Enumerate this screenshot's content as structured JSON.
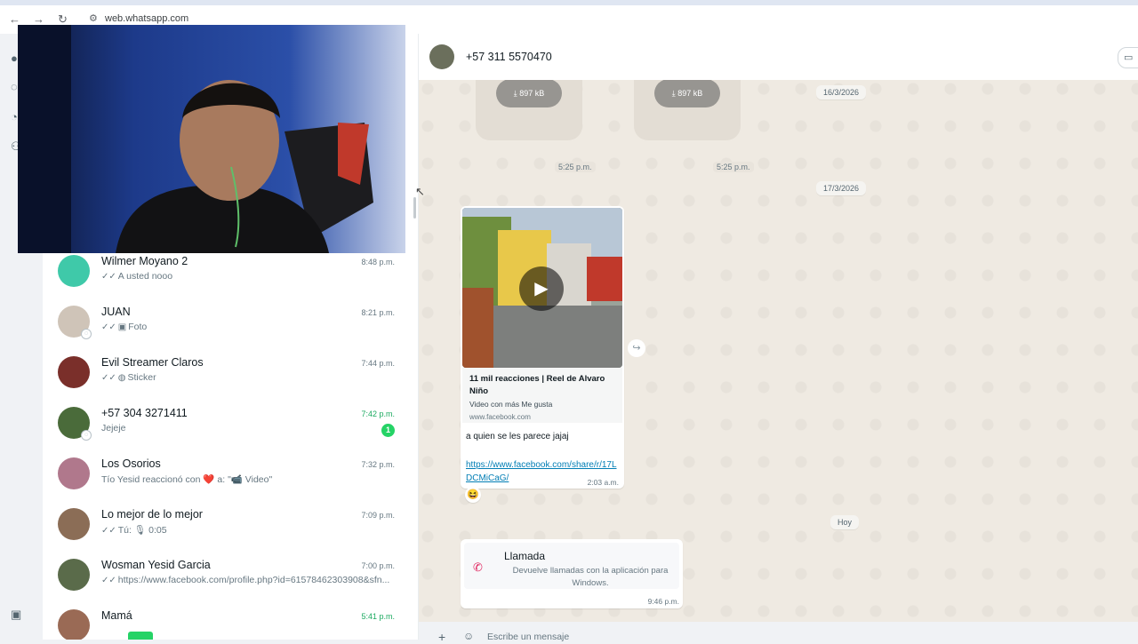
{
  "browser": {
    "url": "web.whatsapp.com"
  },
  "chat_list": [
    {
      "name": "Wilmer Moyano 2",
      "preview": "A usted nooo",
      "time": "8:48 p.m.",
      "ticks": true,
      "avatar_color": "#3fc9a9"
    },
    {
      "name": "JUAN",
      "preview": "Foto",
      "time": "8:21 p.m.",
      "ticks": true,
      "preview_icon": "photo-icon",
      "avatar_color": "#cfc4b8"
    },
    {
      "name": "Evil Streamer Claros",
      "preview": "Sticker",
      "time": "7:44 p.m.",
      "ticks": true,
      "preview_icon": "sticker-icon",
      "avatar_color": "#7a2f2a"
    },
    {
      "name": "+57 304 3271411",
      "preview": "Jejeje",
      "time": "7:42 p.m.",
      "unread_count": "1",
      "avatar_color": "#4a6b3a"
    },
    {
      "name": "Los Osorios",
      "preview": "Tío Yesid reaccionó con ❤️ a: \"📹 Video\"",
      "time": "7:32 p.m.",
      "avatar_color": "#b0788c"
    },
    {
      "name": "Lo mejor de lo mejor",
      "preview": "Tú: 🎙 0:05",
      "time": "7:09 p.m.",
      "ticks": true,
      "avatar_color": "#8b6d56"
    },
    {
      "name": "Wosman Yesid Garcia",
      "preview": "https://www.facebook.com/profile.php?id=61578462303908&sfn...",
      "time": "7:00 p.m.",
      "ticks": true,
      "avatar_color": "#5a6b4a"
    },
    {
      "name": "Mamá",
      "preview": "",
      "time": "5:41 p.m.",
      "avatar_color": "#9a6a55"
    }
  ],
  "chat": {
    "title": "+57 311 5570470",
    "media_size_1": "897 kB",
    "media_size_2": "897 kB",
    "media_time_1": "5:25 p.m.",
    "media_time_2": "5:25 p.m.",
    "date_1": "16/3/2026",
    "date_2": "17/3/2026",
    "date_today": "Hoy",
    "message": {
      "link_title": "11 mil reacciones | Reel de Alvaro Niño",
      "link_description": "Video con más Me gusta",
      "link_domain": "www.facebook.com",
      "text": "a quien se les parece jajaj",
      "url": "https://www.facebook.com/share/r/17LDCMiCaG/",
      "time": "2:03 a.m.",
      "reaction": "😆"
    },
    "call": {
      "title": "Llamada",
      "description": "Devuelve llamadas con la aplicación para Windows.",
      "time": "9:46 p.m."
    },
    "composer_placeholder": "Escribe un mensaje"
  },
  "colors": {
    "accent": "#25d366",
    "unread_time": "#1daa61",
    "link": "#027eb5",
    "call_icon": "#e0245e"
  }
}
